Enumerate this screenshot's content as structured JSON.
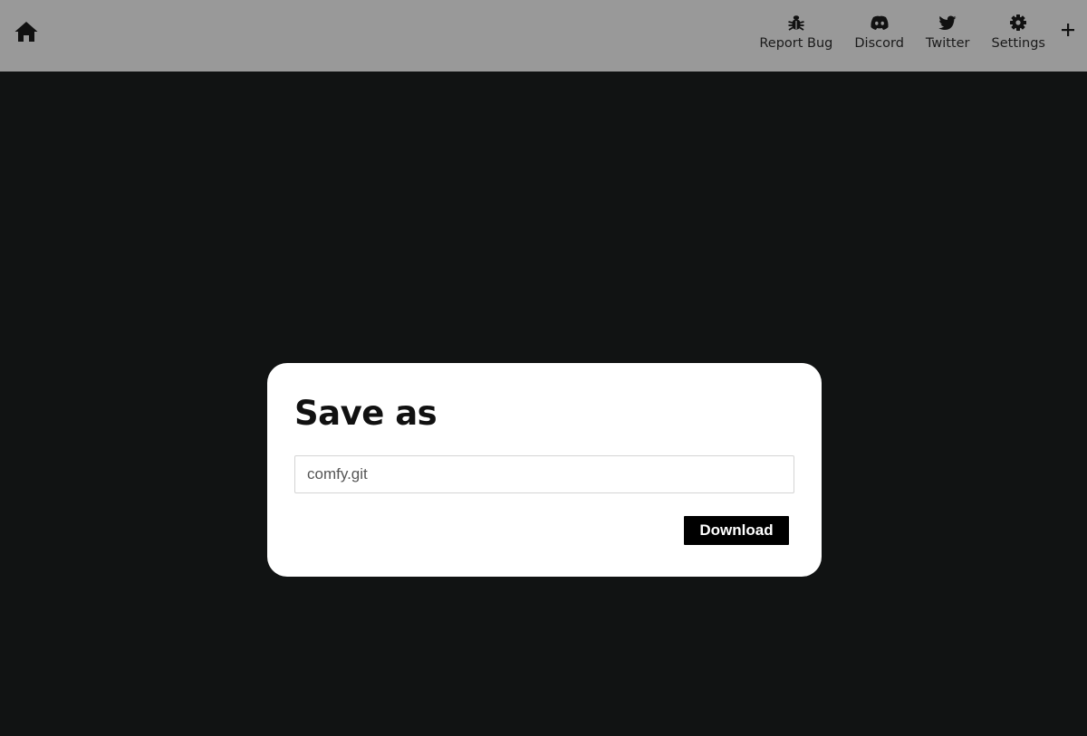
{
  "header": {
    "home_icon": "home-icon",
    "nav_items": [
      {
        "label": "Report Bug",
        "icon": "bug-icon"
      },
      {
        "label": "Discord",
        "icon": "discord-icon"
      },
      {
        "label": "Twitter",
        "icon": "twitter-icon"
      },
      {
        "label": "Settings",
        "icon": "gear-icon"
      }
    ],
    "plus_icon": "plus-icon"
  },
  "dialog": {
    "title": "Save as",
    "filename_value": "comfy.git",
    "download_label": "Download"
  },
  "colors": {
    "header_bg": "#999999",
    "page_bg": "#111313",
    "dialog_bg": "#ffffff",
    "button_bg": "#000000"
  }
}
